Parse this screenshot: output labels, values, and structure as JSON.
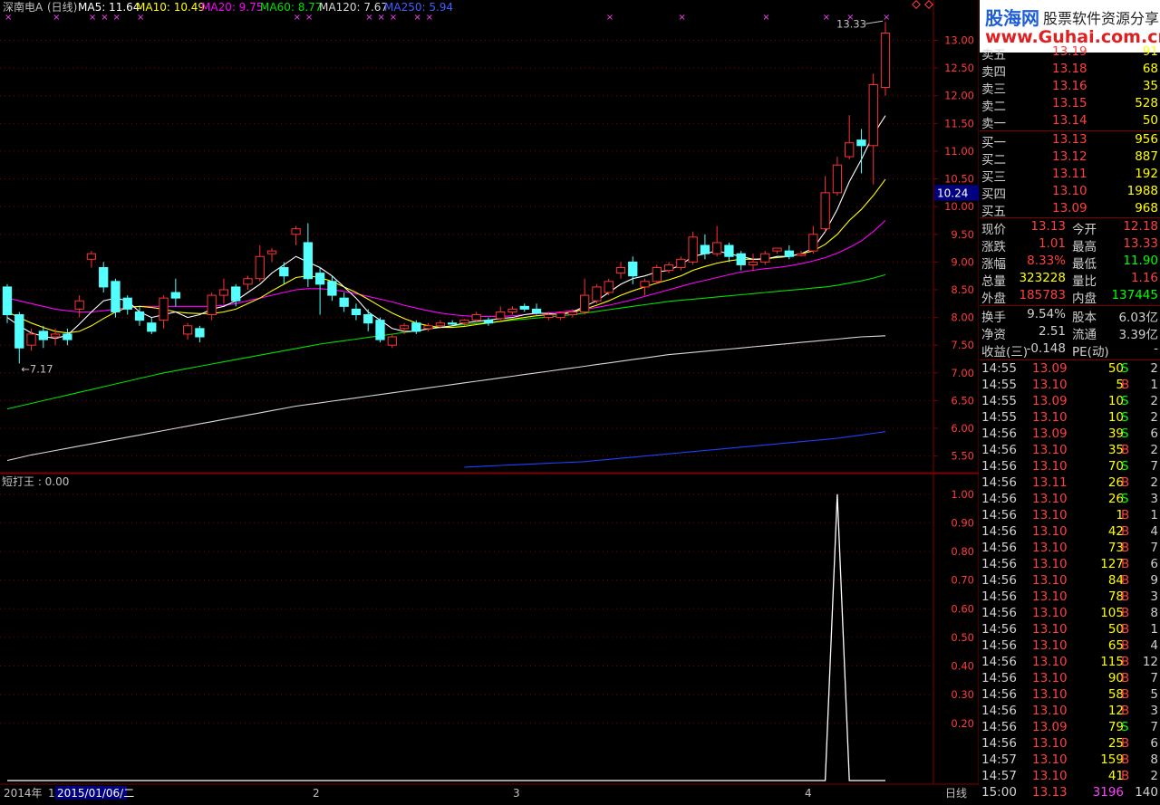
{
  "header": {
    "stock_name": "深南电A",
    "period": "(日线)",
    "ma5": "MA5: 11.64",
    "ma10": "MA10: 10.49",
    "ma20": "MA20: 9.75",
    "ma60": "MA60: 8.77",
    "ma120": "MA120: 7.67",
    "ma250": "MA250: 5.94"
  },
  "sub_title": "短打王 : 0.00",
  "colors": {
    "up": "#ff3232",
    "down": "#54ffff",
    "ma5": "#ffffff",
    "ma10": "#ffff00",
    "ma20": "#ff00ff",
    "ma60": "#00e000",
    "ma120": "#d8d8d8",
    "ma250": "#2040ff",
    "grid": "#800000"
  },
  "chart_data": [
    {
      "type": "candlestick",
      "title": "深南电A (日线)",
      "ylim": [
        5.2,
        13.4
      ],
      "y_ticks": [
        "5.50",
        "6.00",
        "6.50",
        "7.00",
        "7.50",
        "8.00",
        "8.50",
        "9.00",
        "9.50",
        "10.00",
        "10.50",
        "11.00",
        "11.50",
        "12.00",
        "12.50",
        "13.00"
      ],
      "current_price_label": "10.24",
      "high_label": "13.33",
      "low_label": "7.17",
      "candles": [
        [
          8.55,
          8.05,
          8.6,
          7.9
        ],
        [
          8.05,
          7.45,
          8.1,
          7.17
        ],
        [
          7.5,
          7.7,
          7.8,
          7.4
        ],
        [
          7.75,
          7.6,
          7.85,
          7.45
        ],
        [
          7.65,
          7.7,
          7.8,
          7.5
        ],
        [
          7.7,
          7.6,
          7.8,
          7.5
        ],
        [
          8.15,
          8.3,
          8.4,
          8.0
        ],
        [
          9.05,
          9.15,
          9.2,
          8.9
        ],
        [
          8.9,
          8.55,
          9.0,
          8.45
        ],
        [
          8.65,
          8.1,
          8.7,
          8.0
        ],
        [
          8.35,
          8.15,
          8.4,
          8.05
        ],
        [
          8.1,
          7.95,
          8.2,
          7.85
        ],
        [
          7.9,
          7.75,
          8.0,
          7.7
        ],
        [
          7.95,
          8.35,
          8.4,
          7.8
        ],
        [
          8.45,
          8.35,
          8.7,
          8.2
        ],
        [
          7.7,
          7.85,
          7.9,
          7.6
        ],
        [
          7.8,
          7.65,
          7.85,
          7.55
        ],
        [
          8.05,
          8.4,
          8.45,
          7.95
        ],
        [
          8.4,
          8.5,
          8.7,
          8.25
        ],
        [
          8.55,
          8.3,
          8.6,
          8.2
        ],
        [
          8.6,
          8.7,
          8.75,
          8.5
        ],
        [
          8.7,
          9.1,
          9.3,
          8.65
        ],
        [
          9.15,
          9.2,
          9.25,
          9.0
        ],
        [
          8.9,
          8.75,
          9.0,
          8.6
        ],
        [
          9.5,
          9.6,
          9.65,
          9.3
        ],
        [
          9.35,
          8.7,
          9.7,
          8.55
        ],
        [
          8.8,
          8.6,
          8.9,
          8.05
        ],
        [
          8.65,
          8.4,
          8.75,
          8.3
        ],
        [
          8.35,
          8.2,
          8.45,
          8.1
        ],
        [
          8.15,
          8.05,
          8.25,
          7.95
        ],
        [
          8.05,
          7.9,
          8.15,
          7.75
        ],
        [
          7.95,
          7.6,
          8.0,
          7.55
        ],
        [
          7.5,
          7.65,
          7.7,
          7.45
        ],
        [
          7.8,
          7.85,
          7.9,
          7.7
        ],
        [
          7.9,
          7.75,
          7.95,
          7.7
        ],
        [
          7.8,
          7.85,
          7.9,
          7.75
        ],
        [
          7.85,
          7.9,
          7.95,
          7.8
        ],
        [
          7.9,
          7.88,
          7.95,
          7.85
        ],
        [
          7.9,
          7.95,
          7.97,
          7.85
        ],
        [
          7.95,
          8.05,
          8.1,
          7.9
        ],
        [
          7.95,
          7.9,
          8.0,
          7.85
        ],
        [
          7.98,
          8.1,
          8.2,
          7.95
        ],
        [
          8.1,
          8.15,
          8.2,
          8.05
        ],
        [
          8.2,
          8.15,
          8.25,
          8.1
        ],
        [
          8.15,
          8.08,
          8.25,
          8.05
        ],
        [
          8.0,
          8.05,
          8.1,
          7.95
        ],
        [
          8.0,
          8.08,
          8.1,
          7.95
        ],
        [
          8.05,
          8.1,
          8.15,
          8.0
        ],
        [
          8.1,
          8.4,
          8.7,
          8.05
        ],
        [
          8.3,
          8.55,
          8.6,
          8.25
        ],
        [
          8.45,
          8.65,
          8.7,
          8.4
        ],
        [
          8.8,
          8.9,
          9.0,
          8.7
        ],
        [
          9.0,
          8.75,
          9.1,
          8.6
        ],
        [
          8.55,
          8.65,
          8.7,
          8.4
        ],
        [
          8.65,
          8.9,
          8.95,
          8.6
        ],
        [
          8.85,
          8.95,
          9.0,
          8.8
        ],
        [
          8.9,
          9.05,
          9.1,
          8.85
        ],
        [
          9.0,
          9.45,
          9.55,
          8.95
        ],
        [
          9.3,
          9.15,
          9.5,
          9.05
        ],
        [
          9.15,
          9.35,
          9.65,
          9.1
        ],
        [
          9.3,
          9.1,
          9.35,
          9.0
        ],
        [
          9.15,
          8.95,
          9.2,
          8.85
        ],
        [
          8.95,
          9.0,
          9.15,
          8.85
        ],
        [
          9.0,
          9.15,
          9.2,
          8.95
        ],
        [
          9.2,
          9.25,
          9.25,
          9.15
        ],
        [
          9.2,
          9.1,
          9.3,
          9.05
        ],
        [
          9.12,
          9.15,
          9.2,
          9.1
        ],
        [
          9.2,
          9.5,
          9.65,
          9.15
        ],
        [
          9.6,
          10.25,
          10.55,
          9.55
        ],
        [
          10.25,
          10.75,
          10.9,
          10.2
        ],
        [
          10.9,
          11.15,
          11.65,
          10.85
        ],
        [
          11.2,
          11.1,
          11.4,
          10.6
        ],
        [
          11.1,
          12.2,
          12.4,
          10.4
        ],
        [
          12.15,
          13.13,
          13.33,
          12.0
        ]
      ],
      "ma5": [
        8.0,
        7.85,
        7.72,
        7.66,
        7.62,
        7.68,
        7.88,
        8.1,
        8.3,
        8.35,
        8.3,
        8.1,
        8.0,
        8.05,
        8.1,
        8.0,
        8.05,
        8.15,
        8.2,
        8.3,
        8.45,
        8.6,
        8.8,
        8.95,
        9.1,
        9.0,
        8.9,
        8.75,
        8.55,
        8.35,
        8.1,
        7.95,
        7.8,
        7.75,
        7.75,
        7.8,
        7.82,
        7.85,
        7.9,
        7.93,
        7.95,
        7.98,
        8.0,
        8.05,
        8.08,
        8.07,
        8.05,
        8.1,
        8.2,
        8.3,
        8.45,
        8.6,
        8.7,
        8.75,
        8.82,
        8.85,
        8.95,
        9.1,
        9.15,
        9.2,
        9.15,
        9.1,
        9.05,
        9.05,
        9.1,
        9.1,
        9.15,
        9.25,
        9.55,
        9.95,
        10.45,
        10.85,
        11.3,
        11.64
      ],
      "ma10": [
        8.1,
        8.0,
        7.9,
        7.82,
        7.75,
        7.72,
        7.75,
        7.85,
        7.98,
        8.1,
        8.18,
        8.2,
        8.18,
        8.15,
        8.1,
        8.08,
        8.07,
        8.07,
        8.1,
        8.15,
        8.25,
        8.35,
        8.48,
        8.6,
        8.72,
        8.75,
        8.72,
        8.65,
        8.55,
        8.45,
        8.33,
        8.2,
        8.08,
        7.98,
        7.9,
        7.85,
        7.82,
        7.82,
        7.84,
        7.87,
        7.9,
        7.93,
        7.97,
        8.0,
        8.03,
        8.05,
        8.07,
        8.1,
        8.15,
        8.22,
        8.3,
        8.4,
        8.48,
        8.55,
        8.62,
        8.68,
        8.75,
        8.85,
        8.92,
        8.98,
        9.02,
        9.05,
        9.05,
        9.06,
        9.08,
        9.1,
        9.15,
        9.2,
        9.32,
        9.5,
        9.75,
        9.95,
        10.2,
        10.49
      ],
      "ma20": [
        8.35,
        8.3,
        8.25,
        8.2,
        8.15,
        8.12,
        8.1,
        8.1,
        8.12,
        8.15,
        8.18,
        8.2,
        8.2,
        8.2,
        8.2,
        8.2,
        8.2,
        8.2,
        8.22,
        8.25,
        8.3,
        8.35,
        8.4,
        8.45,
        8.5,
        8.52,
        8.52,
        8.5,
        8.47,
        8.43,
        8.38,
        8.33,
        8.28,
        8.22,
        8.17,
        8.12,
        8.08,
        8.05,
        8.03,
        8.02,
        8.02,
        8.02,
        8.03,
        8.05,
        8.07,
        8.08,
        8.1,
        8.12,
        8.15,
        8.18,
        8.22,
        8.27,
        8.32,
        8.38,
        8.44,
        8.5,
        8.56,
        8.62,
        8.67,
        8.72,
        8.77,
        8.82,
        8.85,
        8.88,
        8.9,
        8.93,
        8.97,
        9.02,
        9.08,
        9.16,
        9.26,
        9.38,
        9.55,
        9.75
      ],
      "ma60": [
        6.35,
        6.4,
        6.45,
        6.5,
        6.55,
        6.6,
        6.65,
        6.7,
        6.75,
        6.8,
        6.85,
        6.9,
        6.95,
        7.0,
        7.04,
        7.08,
        7.12,
        7.16,
        7.2,
        7.24,
        7.28,
        7.32,
        7.36,
        7.4,
        7.44,
        7.48,
        7.52,
        7.55,
        7.58,
        7.61,
        7.64,
        7.67,
        7.7,
        7.73,
        7.76,
        7.79,
        7.82,
        7.85,
        7.87,
        7.89,
        7.91,
        7.93,
        7.95,
        7.97,
        7.99,
        8.01,
        8.03,
        8.05,
        8.08,
        8.11,
        8.14,
        8.17,
        8.2,
        8.23,
        8.26,
        8.29,
        8.31,
        8.33,
        8.35,
        8.37,
        8.39,
        8.41,
        8.43,
        8.45,
        8.47,
        8.49,
        8.51,
        8.53,
        8.55,
        8.58,
        8.62,
        8.66,
        8.71,
        8.77
      ],
      "ma120": [
        5.42,
        5.47,
        5.52,
        5.56,
        5.6,
        5.64,
        5.68,
        5.72,
        5.76,
        5.8,
        5.84,
        5.88,
        5.92,
        5.96,
        6.0,
        6.04,
        6.08,
        6.12,
        6.16,
        6.2,
        6.24,
        6.28,
        6.32,
        6.36,
        6.4,
        6.43,
        6.46,
        6.49,
        6.52,
        6.55,
        6.58,
        6.61,
        6.64,
        6.67,
        6.7,
        6.73,
        6.76,
        6.79,
        6.82,
        6.85,
        6.88,
        6.91,
        6.94,
        6.97,
        7.0,
        7.03,
        7.06,
        7.09,
        7.12,
        7.15,
        7.18,
        7.21,
        7.24,
        7.27,
        7.3,
        7.33,
        7.35,
        7.37,
        7.39,
        7.41,
        7.43,
        7.45,
        7.47,
        7.49,
        7.51,
        7.53,
        7.55,
        7.57,
        7.59,
        7.61,
        7.63,
        7.65,
        7.66,
        7.67
      ],
      "ma250": [
        null,
        null,
        null,
        null,
        null,
        null,
        null,
        null,
        null,
        null,
        null,
        null,
        null,
        null,
        null,
        null,
        null,
        null,
        null,
        null,
        null,
        null,
        null,
        null,
        null,
        null,
        null,
        null,
        null,
        null,
        null,
        null,
        null,
        null,
        null,
        null,
        null,
        null,
        5.3,
        5.31,
        5.32,
        5.33,
        5.34,
        5.35,
        5.36,
        5.37,
        5.38,
        5.39,
        5.4,
        5.42,
        5.44,
        5.46,
        5.48,
        5.5,
        5.52,
        5.54,
        5.56,
        5.58,
        5.6,
        5.62,
        5.64,
        5.66,
        5.68,
        5.7,
        5.72,
        5.74,
        5.76,
        5.78,
        5.8,
        5.82,
        5.85,
        5.88,
        5.91,
        5.94
      ],
      "signal_marks_x": [
        0,
        4,
        7,
        8,
        9,
        11,
        24,
        25,
        30,
        31,
        32,
        34,
        35,
        50,
        56,
        63,
        68,
        70,
        73
      ]
    },
    {
      "type": "line",
      "title": "短打王",
      "ylim": [
        0,
        1.05
      ],
      "y_ticks": [
        "0.20",
        "0.30",
        "0.40",
        "0.50",
        "0.60",
        "0.70",
        "0.80",
        "0.90",
        "1.00"
      ],
      "values": [
        0,
        0,
        0,
        0,
        0,
        0,
        0,
        0,
        0,
        0,
        0,
        0,
        0,
        0,
        0,
        0,
        0,
        0,
        0,
        0,
        0,
        0,
        0,
        0,
        0,
        0,
        0,
        0,
        0,
        0,
        0,
        0,
        0,
        0,
        0,
        0,
        0,
        0,
        0,
        0,
        0,
        0,
        0,
        0,
        0,
        0,
        0,
        0,
        0,
        0,
        0,
        0,
        0,
        0,
        0,
        0,
        0,
        0,
        0,
        0,
        0,
        0,
        0,
        0,
        0,
        0,
        0,
        0,
        0,
        1,
        0,
        0,
        0,
        0
      ]
    }
  ],
  "footer": {
    "year_label": "2014年",
    "label_1": "1",
    "date_label": "2015/01/06/二",
    "month_2": "2",
    "month_3": "3",
    "month_4": "4",
    "period_button": "日线"
  },
  "logo": {
    "name": "股海网",
    "slogan": "股票软件资源分享",
    "url": "www.Guhai.com.cn"
  },
  "quote": {
    "asks": [
      {
        "label": "卖五",
        "price": "13.19",
        "vol": "91"
      },
      {
        "label": "卖四",
        "price": "13.18",
        "vol": "68"
      },
      {
        "label": "卖三",
        "price": "13.16",
        "vol": "35"
      },
      {
        "label": "卖二",
        "price": "13.15",
        "vol": "528"
      },
      {
        "label": "卖一",
        "price": "13.14",
        "vol": "50"
      }
    ],
    "bids": [
      {
        "label": "买一",
        "price": "13.13",
        "vol": "956"
      },
      {
        "label": "买二",
        "price": "13.12",
        "vol": "887"
      },
      {
        "label": "买三",
        "price": "13.11",
        "vol": "192"
      },
      {
        "label": "买四",
        "price": "13.10",
        "vol": "1988"
      },
      {
        "label": "买五",
        "price": "13.09",
        "vol": "968"
      }
    ],
    "stats": [
      {
        "l1": "现价",
        "v1": "13.13",
        "l2": "今开",
        "v2": "12.18",
        "c1": "#ff4040",
        "c2": "#ff4040"
      },
      {
        "l1": "涨跌",
        "v1": "1.01",
        "l2": "最高",
        "v2": "13.33",
        "c1": "#ff4040",
        "c2": "#ff4040"
      },
      {
        "l1": "涨幅",
        "v1": "8.33%",
        "l2": "最低",
        "v2": "11.90",
        "c1": "#ff4040",
        "c2": "#00ff00"
      },
      {
        "l1": "总量",
        "v1": "323228",
        "l2": "量比",
        "v2": "1.16",
        "c1": "#ffff00",
        "c2": "#ff4040"
      },
      {
        "l1": "外盘",
        "v1": "185783",
        "l2": "内盘",
        "v2": "137445",
        "c1": "#ff4040",
        "c2": "#00ff00"
      }
    ],
    "stats2": [
      {
        "l1": "换手",
        "v1": "9.54%",
        "l2": "股本",
        "v2": "6.03亿"
      },
      {
        "l1": "净资",
        "v1": "2.51",
        "l2": "流通",
        "v2": "3.39亿"
      },
      {
        "l1": "收益(三)",
        "v1": "-0.148",
        "l2": "PE(动)",
        "v2": "-"
      }
    ],
    "ticks": [
      [
        "14:55",
        "13.09",
        "50",
        "S",
        "2"
      ],
      [
        "14:55",
        "13.10",
        "5",
        "B",
        "1"
      ],
      [
        "14:55",
        "13.09",
        "10",
        "S",
        "2"
      ],
      [
        "14:55",
        "13.10",
        "10",
        "S",
        "2"
      ],
      [
        "14:56",
        "13.09",
        "39",
        "S",
        "6"
      ],
      [
        "14:56",
        "13.10",
        "35",
        "B",
        "2"
      ],
      [
        "14:56",
        "13.10",
        "70",
        "S",
        "7"
      ],
      [
        "14:56",
        "13.11",
        "26",
        "B",
        "2"
      ],
      [
        "14:56",
        "13.10",
        "26",
        "S",
        "3"
      ],
      [
        "14:56",
        "13.10",
        "1",
        "B",
        "1"
      ],
      [
        "14:56",
        "13.10",
        "42",
        "B",
        "4"
      ],
      [
        "14:56",
        "13.10",
        "73",
        "B",
        "7"
      ],
      [
        "14:56",
        "13.10",
        "127",
        "B",
        "6"
      ],
      [
        "14:56",
        "13.10",
        "84",
        "B",
        "9"
      ],
      [
        "14:56",
        "13.10",
        "78",
        "B",
        "3"
      ],
      [
        "14:56",
        "13.10",
        "105",
        "B",
        "8"
      ],
      [
        "14:56",
        "13.10",
        "50",
        "B",
        "1"
      ],
      [
        "14:56",
        "13.10",
        "65",
        "B",
        "4"
      ],
      [
        "14:56",
        "13.10",
        "115",
        "B",
        "12"
      ],
      [
        "14:56",
        "13.10",
        "90",
        "B",
        "7"
      ],
      [
        "14:56",
        "13.10",
        "58",
        "B",
        "5"
      ],
      [
        "14:56",
        "13.10",
        "12",
        "B",
        "3"
      ],
      [
        "14:56",
        "13.09",
        "79",
        "S",
        "7"
      ],
      [
        "14:56",
        "13.10",
        "25",
        "B",
        "6"
      ],
      [
        "14:57",
        "13.10",
        "159",
        "B",
        "8"
      ],
      [
        "14:57",
        "13.10",
        "41",
        "B",
        "2"
      ],
      [
        "15:00",
        "13.13",
        "3196",
        "",
        "140"
      ]
    ]
  }
}
